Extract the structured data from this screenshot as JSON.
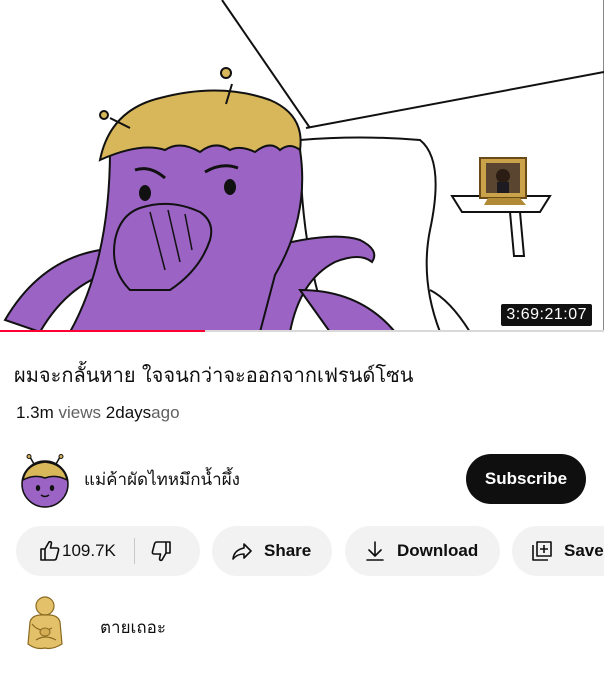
{
  "video": {
    "duration": "3:69:21:07",
    "progress_fraction": 0.34
  },
  "title": "ผมจะกลั้นหาย ใจจนกว่าจะออกจากเฟรนด์โซน",
  "meta": {
    "views_count": "1.3m",
    "views_label": "views",
    "age_count": "2days",
    "age_label": "ago"
  },
  "channel": {
    "name": "แม่ค้าผัดไทหมึกน้ำผึ้ง",
    "subscribe_label": "Subscribe"
  },
  "actions": {
    "like_count": "109.7K",
    "share_label": "Share",
    "download_label": "Download",
    "save_label": "Save"
  },
  "comment": {
    "text": "ตายเถอะ"
  },
  "colors": {
    "character_purple": "#9b63c4",
    "hat_gold": "#d8b65a",
    "progress_red": "#ff0033",
    "subscribe_bg": "#0f0f0f"
  }
}
